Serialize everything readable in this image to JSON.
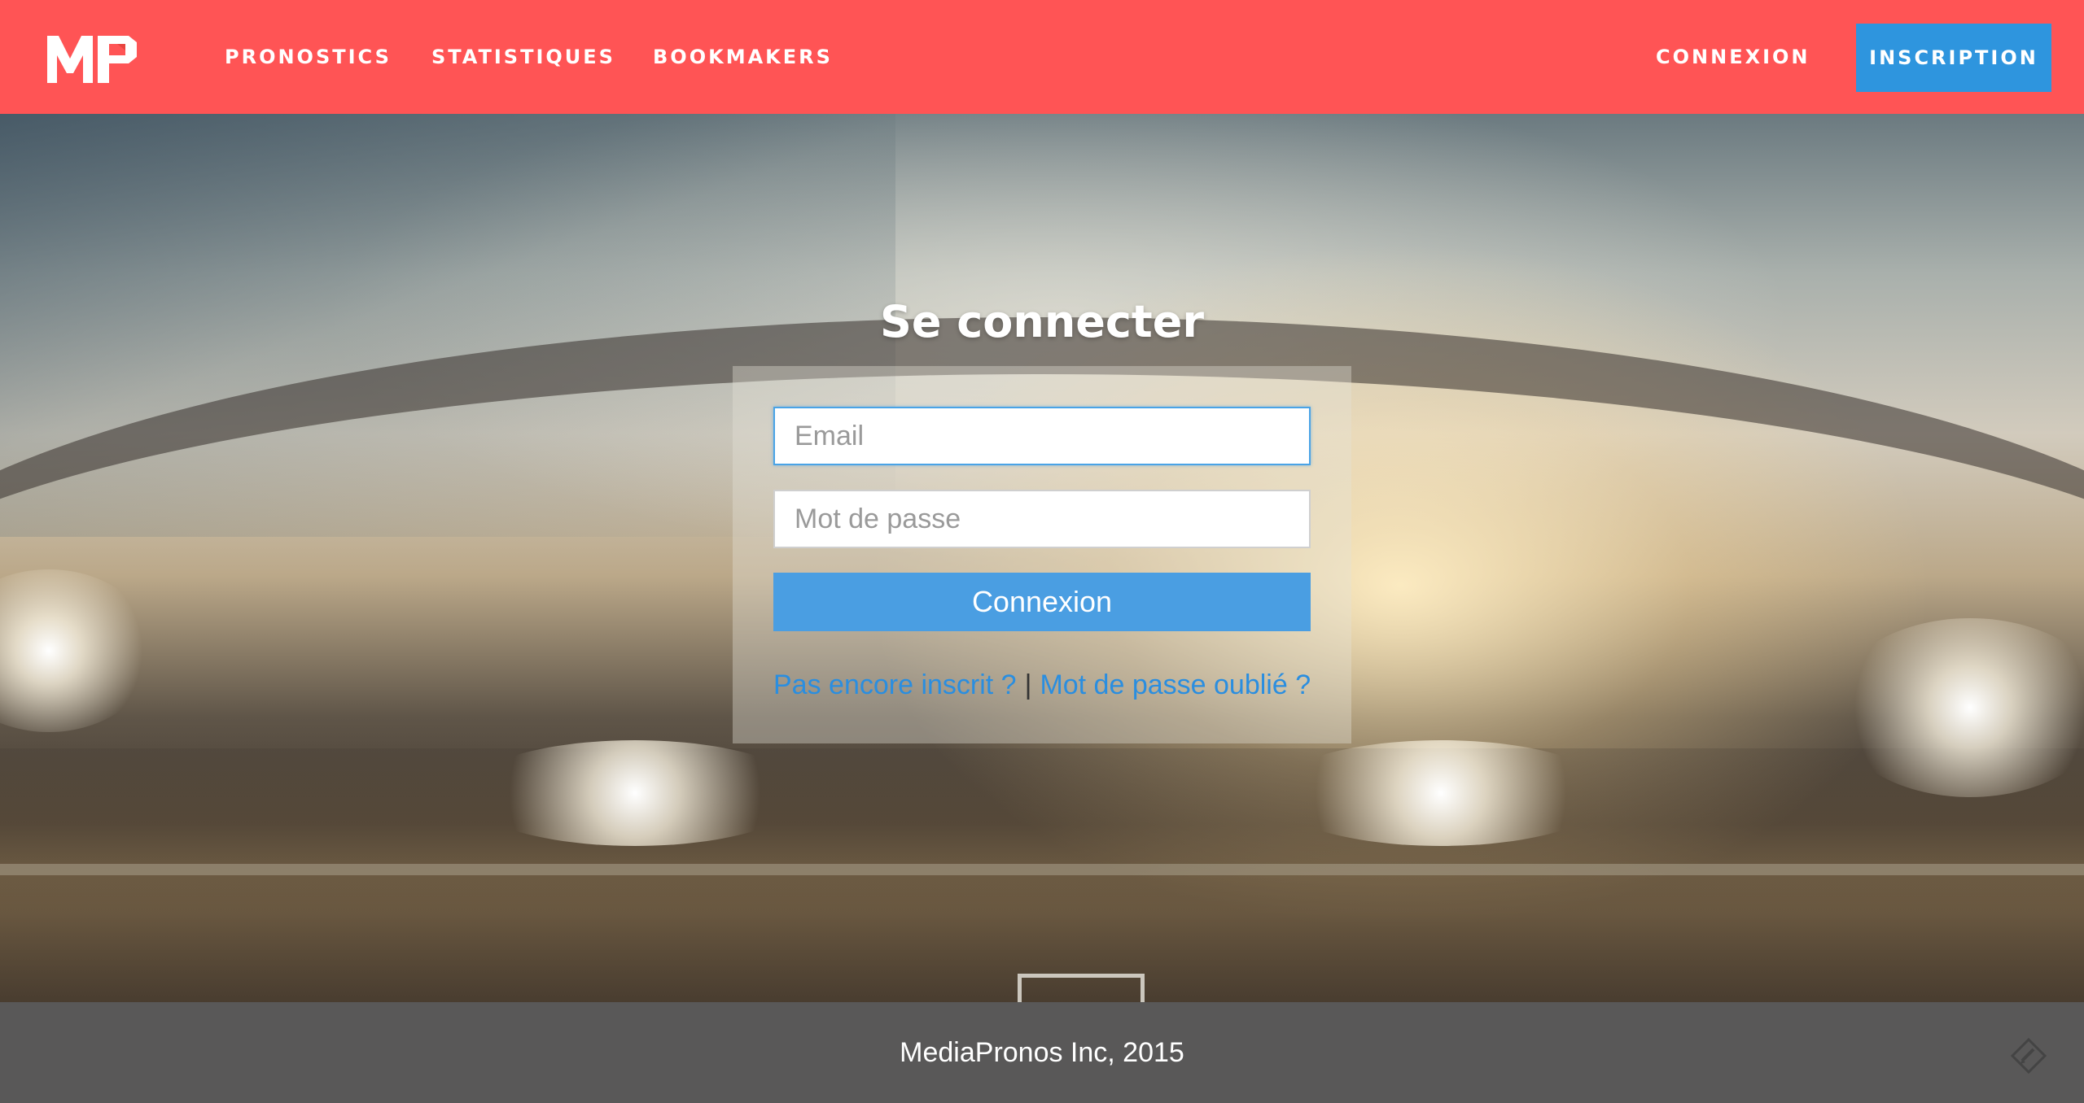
{
  "header": {
    "logo_icon": "mp-logo-icon",
    "nav": [
      {
        "label": "PRONOSTICS"
      },
      {
        "label": "STATISTIQUES"
      },
      {
        "label": "BOOKMAKERS"
      }
    ],
    "login_label": "CONNEXION",
    "signup_label": "INSCRIPTION"
  },
  "login": {
    "title": "Se connecter",
    "email_placeholder": "Email",
    "email_value": "",
    "password_placeholder": "Mot de passe",
    "password_value": "",
    "submit_label": "Connexion",
    "register_link": "Pas encore inscrit ?",
    "separator": "|",
    "forgot_link": "Mot de passe oublié ?"
  },
  "footer": {
    "copyright": "MediaPronos Inc, 2015",
    "feedback_icon": "pencil-diamond-icon"
  },
  "colors": {
    "header_bg": "#ff5455",
    "signup_bg": "#2e95de",
    "primary_button": "#4a9ee2",
    "link": "#2a8ee0",
    "footer_bg": "#595858"
  }
}
